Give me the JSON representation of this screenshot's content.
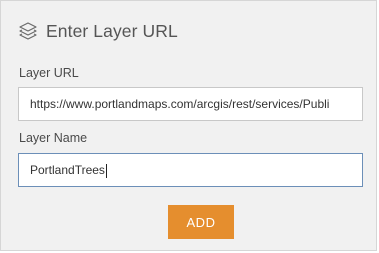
{
  "header": {
    "icon": "layers-icon",
    "title": "Enter Layer URL"
  },
  "layer_url": {
    "label": "Layer URL",
    "value": "https://www.portlandmaps.com/arcgis/rest/services/Publi"
  },
  "layer_name": {
    "label": "Layer Name",
    "value": "PortlandTrees"
  },
  "actions": {
    "add_label": "ADD"
  },
  "colors": {
    "panel_background": "#f1f1f1",
    "add_button": "#e58e2e",
    "focused_input_border": "#6c8fb8"
  }
}
